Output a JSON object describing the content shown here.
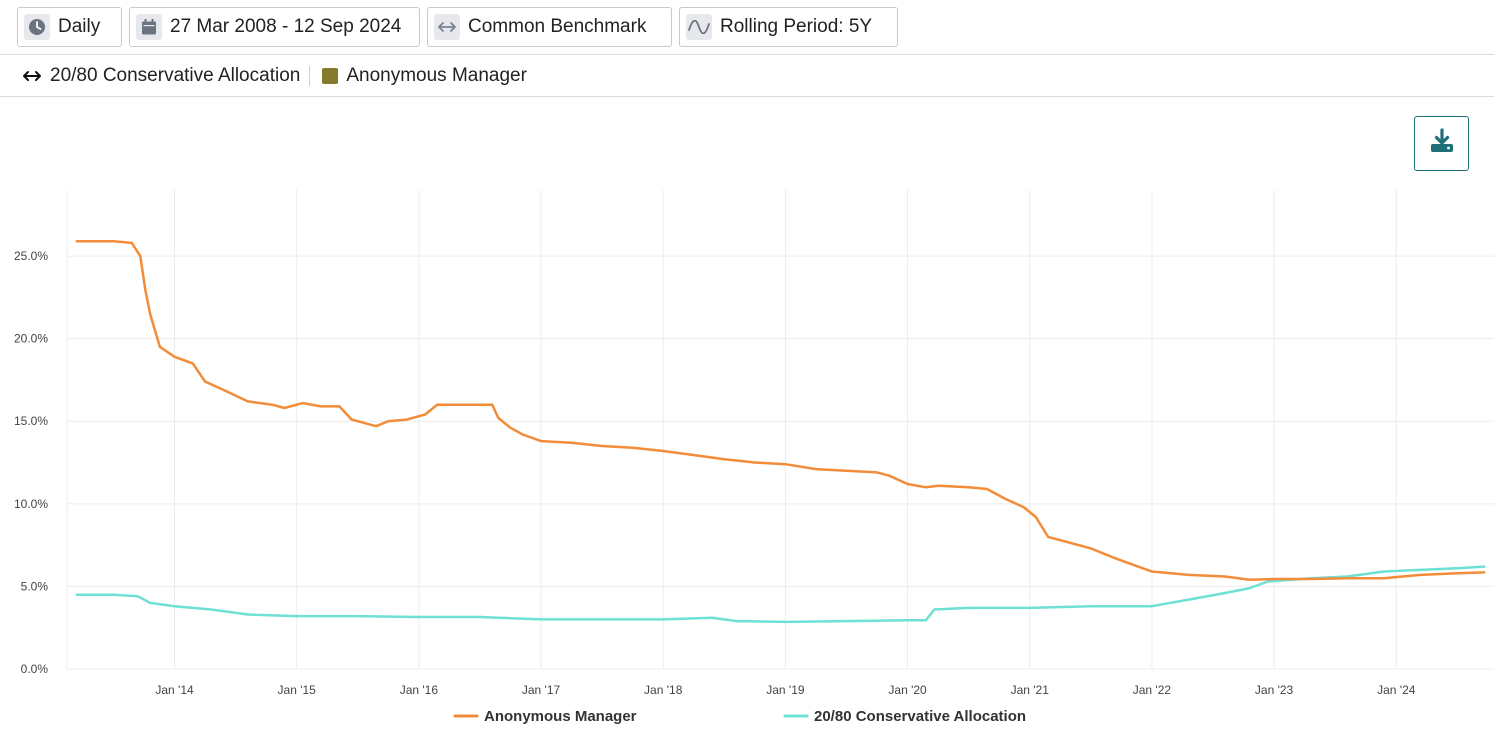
{
  "toolbar": {
    "frequency": "Daily",
    "date_range": "27 Mar 2008 - 12 Sep 2024",
    "benchmark": "Common Benchmark",
    "rolling": "Rolling Period: 5Y"
  },
  "legend_bar": {
    "benchmark_name": "20/80 Conservative Allocation",
    "manager_name": "Anonymous Manager",
    "manager_color": "#857a2d"
  },
  "colors": {
    "manager": "#f28c38",
    "benchmark": "#6ee0d4",
    "grid": "#ececec",
    "download_accent": "#1f6f78"
  },
  "chart_data": {
    "type": "line",
    "x_tick_labels": [
      "Jan '14",
      "Jan '15",
      "Jan '16",
      "Jan '17",
      "Jan '18",
      "Jan '19",
      "Jan '20",
      "Jan '21",
      "Jan '22",
      "Jan '23",
      "Jan '24"
    ],
    "y_tick_labels": [
      "0.0%",
      "5.0%",
      "10.0%",
      "15.0%",
      "20.0%",
      "25.0%"
    ],
    "ylim": [
      0,
      29
    ],
    "xlim": [
      2013.12,
      2024.8
    ],
    "legend_position": "bottom",
    "grid": true,
    "series": [
      {
        "name": "Anonymous Manager",
        "color": "#f28c38",
        "points": [
          [
            2013.2,
            25.9
          ],
          [
            2013.5,
            25.9
          ],
          [
            2013.65,
            25.8
          ],
          [
            2013.72,
            25.0
          ],
          [
            2013.76,
            23.0
          ],
          [
            2013.8,
            21.5
          ],
          [
            2013.88,
            19.5
          ],
          [
            2014.0,
            18.9
          ],
          [
            2014.15,
            18.5
          ],
          [
            2014.25,
            17.4
          ],
          [
            2014.4,
            16.9
          ],
          [
            2014.6,
            16.2
          ],
          [
            2014.8,
            16.0
          ],
          [
            2014.9,
            15.8
          ],
          [
            2015.05,
            16.1
          ],
          [
            2015.2,
            15.9
          ],
          [
            2015.35,
            15.9
          ],
          [
            2015.45,
            15.1
          ],
          [
            2015.65,
            14.7
          ],
          [
            2015.75,
            15.0
          ],
          [
            2015.9,
            15.1
          ],
          [
            2016.05,
            15.4
          ],
          [
            2016.15,
            16.0
          ],
          [
            2016.35,
            16.0
          ],
          [
            2016.5,
            16.0
          ],
          [
            2016.6,
            16.0
          ],
          [
            2016.65,
            15.2
          ],
          [
            2016.75,
            14.6
          ],
          [
            2016.85,
            14.2
          ],
          [
            2017.0,
            13.8
          ],
          [
            2017.25,
            13.7
          ],
          [
            2017.5,
            13.5
          ],
          [
            2017.75,
            13.4
          ],
          [
            2018.0,
            13.2
          ],
          [
            2018.3,
            12.9
          ],
          [
            2018.5,
            12.7
          ],
          [
            2018.75,
            12.5
          ],
          [
            2019.0,
            12.4
          ],
          [
            2019.25,
            12.1
          ],
          [
            2019.5,
            12.0
          ],
          [
            2019.75,
            11.9
          ],
          [
            2019.85,
            11.7
          ],
          [
            2020.0,
            11.2
          ],
          [
            2020.15,
            11.0
          ],
          [
            2020.25,
            11.1
          ],
          [
            2020.5,
            11.0
          ],
          [
            2020.65,
            10.9
          ],
          [
            2020.8,
            10.3
          ],
          [
            2020.95,
            9.8
          ],
          [
            2021.05,
            9.2
          ],
          [
            2021.15,
            8.0
          ],
          [
            2021.3,
            7.7
          ],
          [
            2021.5,
            7.3
          ],
          [
            2021.7,
            6.7
          ],
          [
            2021.85,
            6.3
          ],
          [
            2022.0,
            5.9
          ],
          [
            2022.3,
            5.7
          ],
          [
            2022.6,
            5.6
          ],
          [
            2022.8,
            5.4
          ],
          [
            2023.0,
            5.45
          ],
          [
            2023.3,
            5.45
          ],
          [
            2023.6,
            5.5
          ],
          [
            2023.9,
            5.5
          ],
          [
            2024.2,
            5.7
          ],
          [
            2024.5,
            5.8
          ],
          [
            2024.72,
            5.85
          ]
        ]
      },
      {
        "name": "20/80 Conservative Allocation",
        "color": "#6ee0d4",
        "points": [
          [
            2013.2,
            4.5
          ],
          [
            2013.5,
            4.5
          ],
          [
            2013.7,
            4.4
          ],
          [
            2013.8,
            4.0
          ],
          [
            2014.0,
            3.8
          ],
          [
            2014.3,
            3.6
          ],
          [
            2014.6,
            3.3
          ],
          [
            2015.0,
            3.2
          ],
          [
            2015.5,
            3.2
          ],
          [
            2016.0,
            3.15
          ],
          [
            2016.5,
            3.15
          ],
          [
            2017.0,
            3.0
          ],
          [
            2017.5,
            3.0
          ],
          [
            2018.0,
            3.0
          ],
          [
            2018.4,
            3.1
          ],
          [
            2018.6,
            2.9
          ],
          [
            2019.0,
            2.85
          ],
          [
            2019.5,
            2.9
          ],
          [
            2020.0,
            2.95
          ],
          [
            2020.15,
            2.95
          ],
          [
            2020.22,
            3.6
          ],
          [
            2020.5,
            3.7
          ],
          [
            2021.0,
            3.7
          ],
          [
            2021.5,
            3.8
          ],
          [
            2022.0,
            3.8
          ],
          [
            2022.3,
            4.2
          ],
          [
            2022.6,
            4.6
          ],
          [
            2022.8,
            4.9
          ],
          [
            2022.95,
            5.3
          ],
          [
            2023.3,
            5.5
          ],
          [
            2023.6,
            5.6
          ],
          [
            2023.9,
            5.9
          ],
          [
            2024.2,
            6.0
          ],
          [
            2024.5,
            6.1
          ],
          [
            2024.72,
            6.2
          ]
        ]
      }
    ]
  }
}
